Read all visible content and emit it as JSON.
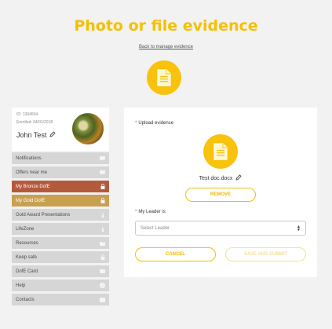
{
  "header": {
    "title": "Photo or file evidence",
    "back_link": "Back to manage evidence"
  },
  "profile": {
    "id_line": "ID: 1304504",
    "enrolled_line": "Enrolled: 04/01/2018",
    "name": "John Test"
  },
  "sidebar": {
    "items": [
      {
        "label": "Notifications",
        "icon": "chat-icon"
      },
      {
        "label": "Offers near me",
        "icon": "chat-icon"
      },
      {
        "label": "My Bronze DofE",
        "icon": "lock-icon"
      },
      {
        "label": "My Gold DofE",
        "icon": "lock-icon"
      },
      {
        "label": "Gold Award Presentations",
        "icon": "tower-icon"
      },
      {
        "label": "LifeZone",
        "icon": "tower-icon"
      },
      {
        "label": "Resources",
        "icon": "folder-icon"
      },
      {
        "label": "Keep safe",
        "icon": "lock-icon"
      },
      {
        "label": "DofE Card",
        "icon": "card-icon"
      },
      {
        "label": "Help",
        "icon": "help-icon"
      },
      {
        "label": "Contacts",
        "icon": "contacts-icon"
      }
    ]
  },
  "form": {
    "upload_label": "Upload evidence",
    "filename": "Test doc.docx",
    "remove_label": "REMOVE",
    "leader_label": "My Leader is",
    "leader_placeholder": "Select Leader",
    "cancel_label": "CANCEL",
    "submit_label": "SAVE AND SUBMIT"
  },
  "colors": {
    "accent": "#f5c000",
    "bronze": "#b45a3c",
    "gold": "#c9a050",
    "required": "#d04a3a"
  }
}
